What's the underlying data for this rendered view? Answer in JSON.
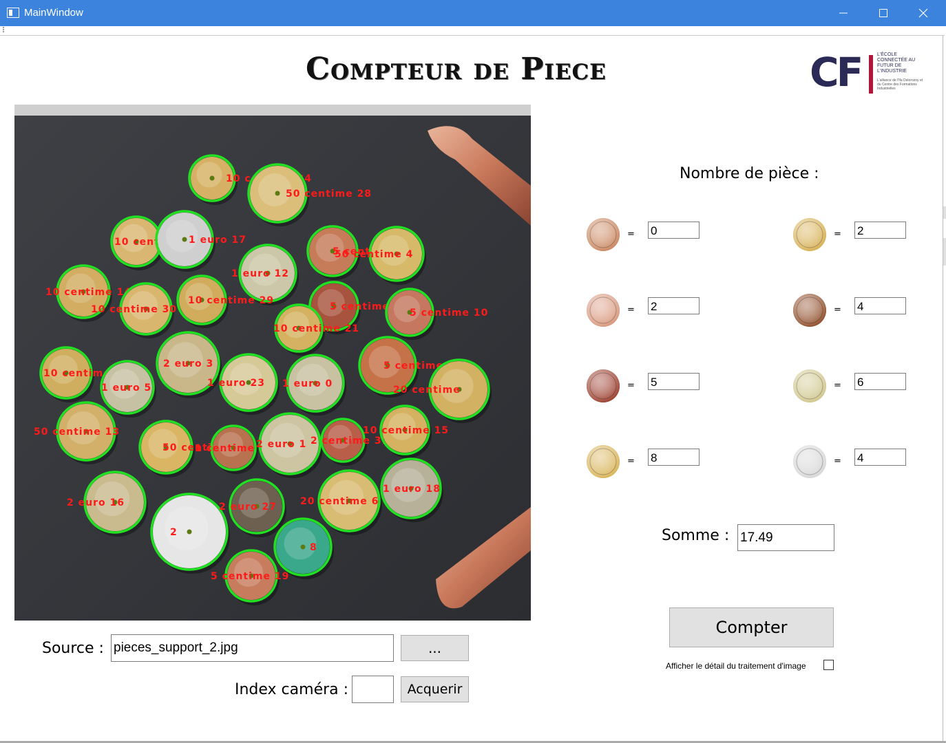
{
  "window": {
    "title": "MainWindow",
    "controls": [
      "minimize",
      "maximize",
      "close"
    ]
  },
  "app_title": "Compteur de Piece",
  "logo": {
    "mark": "CF",
    "tagline": "L'ÉCOLE CONNECTÉE AU FUTUR DE L'INDUSTRIE",
    "subtext": "L'alliance de l'Ifa Delorozoy et du Centre des Formations Industrielles"
  },
  "count_panel": {
    "title": "Nombre de pièce :",
    "equals": "=",
    "coins": [
      {
        "coin": "1-centime",
        "value": "0",
        "color": "#c9845c"
      },
      {
        "coin": "2-centime",
        "value": "2",
        "color": "#d8957a"
      },
      {
        "coin": "5-centime",
        "value": "5",
        "color": "#9a3b2a"
      },
      {
        "coin": "10-centime",
        "value": "8",
        "color": "#d8b255"
      },
      {
        "coin": "20-centime",
        "value": "2",
        "color": "#d6ae50"
      },
      {
        "coin": "50-centime",
        "value": "4",
        "color": "#8f4a26"
      },
      {
        "coin": "1-euro",
        "value": "6",
        "color": "#cfc58a"
      },
      {
        "coin": "2-euro",
        "value": "4",
        "color": "#d6d6d6"
      }
    ]
  },
  "somme": {
    "label": "Somme :",
    "value": "17.49"
  },
  "compter_label": "Compter",
  "detail_label": "Afficher le détail du traitement d'image",
  "source": {
    "label": "Source :",
    "value": "pieces_support_2.jpg",
    "browse_label": "..."
  },
  "camera": {
    "label": "Index caméra :",
    "value": "",
    "acquire_label": "Acquerir"
  },
  "detections": [
    {
      "text": "10 centime 24",
      "color": "#d6b165",
      "ring": "#22e022"
    },
    {
      "text": "50 centime 28",
      "color": "#dbbe7a",
      "ring": "#22e022"
    },
    {
      "text": "10 centime 17",
      "color": "#d9b772",
      "ring": "#22e022"
    },
    {
      "text": "1 euro 17",
      "color": "#cfcfcf",
      "ring": "#22e022"
    },
    {
      "text": "5 centime 9",
      "color": "#c67b59",
      "ring": "#22e022"
    },
    {
      "text": "50 centime 4",
      "color": "#d6ba6a",
      "ring": "#22e022"
    },
    {
      "text": "1 euro 12",
      "color": "#cbc7a8",
      "ring": "#22e022"
    },
    {
      "text": "10 centime 14",
      "color": "#d2ad62",
      "ring": "#22e022"
    },
    {
      "text": "10 centime 30",
      "color": "#d8b66e",
      "ring": "#22e022"
    },
    {
      "text": "10 centime 29",
      "color": "#d1ac5c",
      "ring": "#22e022"
    },
    {
      "text": "5 centime 20",
      "color": "#a8533e",
      "ring": "#22e022"
    },
    {
      "text": "5 centime 10",
      "color": "#c5785f",
      "ring": "#22e022"
    },
    {
      "text": "10 centime 21",
      "color": "#d5b261",
      "ring": "#22e022"
    },
    {
      "text": "2 euro 3",
      "color": "#c9b789",
      "ring": "#22e022"
    },
    {
      "text": "10 centime 25",
      "color": "#cfae60",
      "ring": "#22e022"
    },
    {
      "text": "1 euro 5",
      "color": "#c7c1a3",
      "ring": "#22e022"
    },
    {
      "text": "1 euro 23",
      "color": "#d6c998",
      "ring": "#22e022"
    },
    {
      "text": "1 euro 0",
      "color": "#c8c1a2",
      "ring": "#22e022"
    },
    {
      "text": "5 centime 26",
      "color": "#c67248",
      "ring": "#22e022"
    },
    {
      "text": "20 centime",
      "color": "#d3b162",
      "ring": "#22e022"
    },
    {
      "text": "50 centime 13",
      "color": "#d2b06a",
      "ring": "#22e022"
    },
    {
      "text": "50 centime 7",
      "color": "#d9b564",
      "ring": "#22e022"
    },
    {
      "text": "1 centime 32",
      "color": "#b8724f",
      "ring": "#22e022"
    },
    {
      "text": "2 euro 1",
      "color": "#cdc4a2",
      "ring": "#22e022"
    },
    {
      "text": "2 centime 31",
      "color": "#b95e48",
      "ring": "#22e022"
    },
    {
      "text": "10 centime 15",
      "color": "#d4b262",
      "ring": "#22e022"
    },
    {
      "text": "2 euro 16",
      "color": "#c9bb8e",
      "ring": "#22e022"
    },
    {
      "text": "2",
      "color": "#e6e6e6",
      "ring": "#22e022"
    },
    {
      "text": "2 euro 27",
      "color": "#6e6050",
      "ring": "#22e022"
    },
    {
      "text": "20 centime 6",
      "color": "#d9bc74",
      "ring": "#22e022"
    },
    {
      "text": "1 euro 18",
      "color": "#b7b19a",
      "ring": "#22e022"
    },
    {
      "text": "8",
      "color": "#3aa88b",
      "ring": "#22e022"
    },
    {
      "text": "5 centime 19",
      "color": "#c77d5d",
      "ring": "#22e022"
    }
  ]
}
